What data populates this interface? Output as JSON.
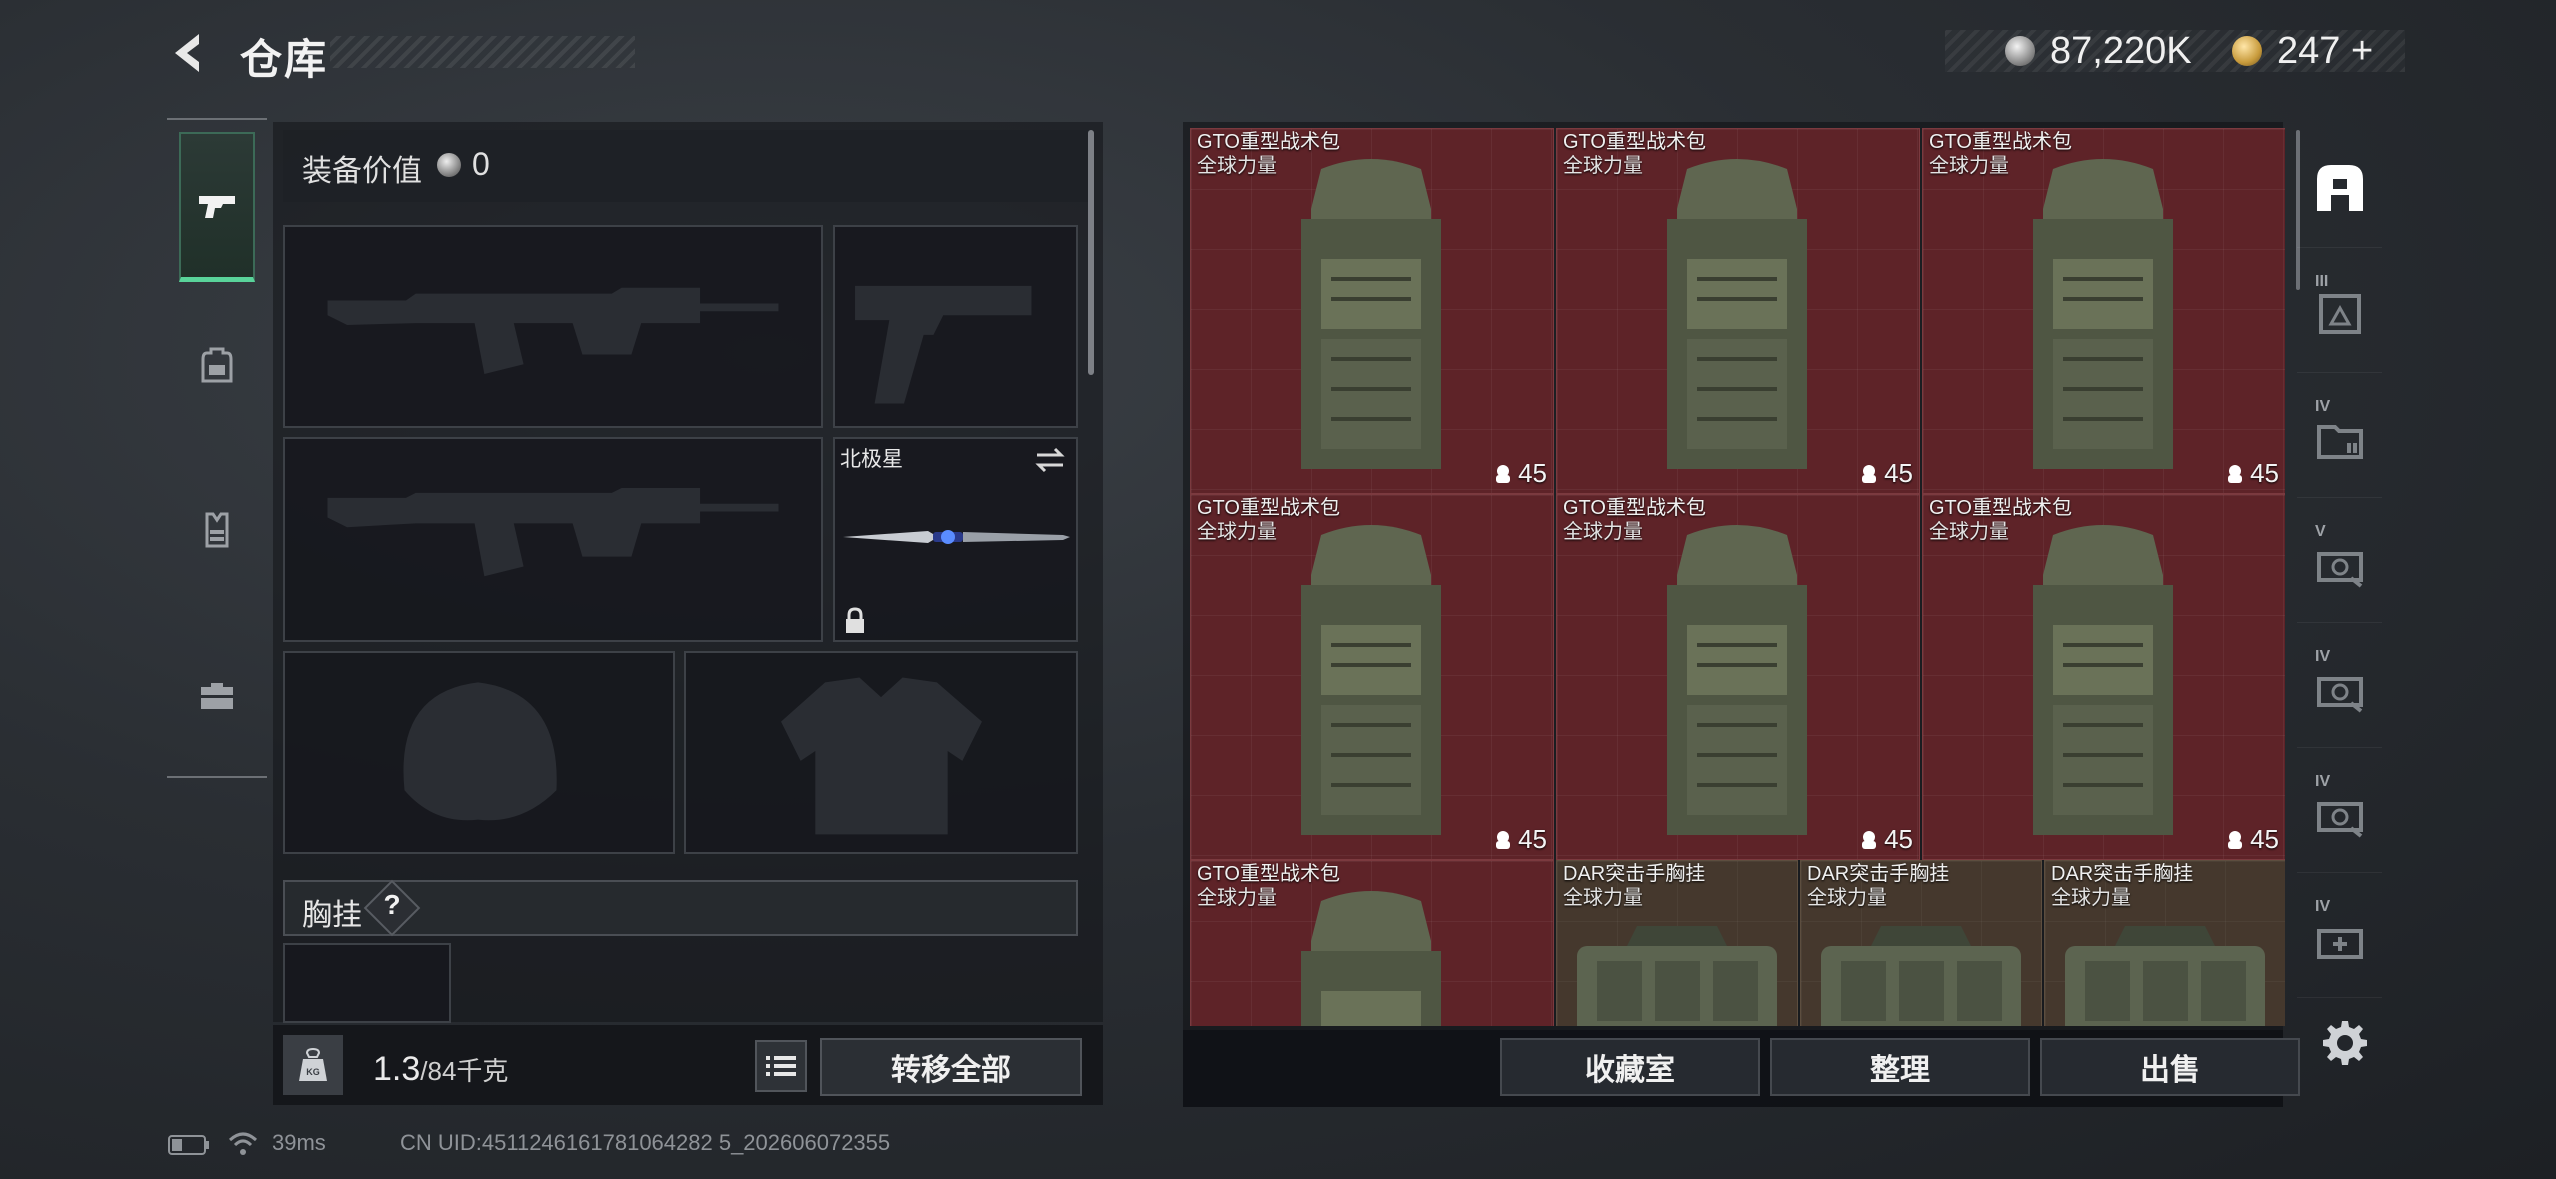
{
  "topbar": {
    "title": "仓库",
    "silver_amount": "87,220K",
    "gold_amount": "247",
    "gold_add": "+"
  },
  "rail": {
    "tabs": [
      {
        "icon": "pistol-icon",
        "active": true
      },
      {
        "icon": "backpack-icon",
        "active": false
      },
      {
        "icon": "chest-rig-icon",
        "active": false
      },
      {
        "icon": "toolbox-icon",
        "active": false
      }
    ]
  },
  "equipment": {
    "value_label": "装备价值",
    "value_amount": "0",
    "melee_name": "北极星",
    "chest_label": "胸挂",
    "chest_help": "?"
  },
  "weight": {
    "current": "1.3",
    "max": "/84千克",
    "unit_icon_text": "KG"
  },
  "actions": {
    "transfer_all": "转移全部",
    "collection": "收藏室",
    "sort": "整理",
    "sell": "出售"
  },
  "storage": {
    "items": [
      {
        "name": "GTO重型战术包",
        "tag": "全球力量",
        "count": "45",
        "kind": "bag"
      },
      {
        "name": "GTO重型战术包",
        "tag": "全球力量",
        "count": "45",
        "kind": "bag"
      },
      {
        "name": "GTO重型战术包",
        "tag": "全球力量",
        "count": "45",
        "kind": "bag"
      },
      {
        "name": "GTO重型战术包",
        "tag": "全球力量",
        "count": "45",
        "kind": "bag"
      },
      {
        "name": "GTO重型战术包",
        "tag": "全球力量",
        "count": "45",
        "kind": "bag"
      },
      {
        "name": "GTO重型战术包",
        "tag": "全球力量",
        "count": "45",
        "kind": "bag"
      },
      {
        "name": "GTO重型战术包",
        "tag": "全球力量",
        "count": "",
        "kind": "bag"
      },
      {
        "name": "DAR突击手胸挂",
        "tag": "全球力量",
        "count": "",
        "kind": "vest"
      },
      {
        "name": "DAR突击手胸挂",
        "tag": "全球力量",
        "count": "",
        "kind": "vest"
      },
      {
        "name": "DAR突击手胸挂",
        "tag": "全球力量",
        "count": "",
        "kind": "vest"
      }
    ]
  },
  "right_rail": {
    "tabs": [
      {
        "icon": "storage-home-icon",
        "level": ""
      },
      {
        "icon": "storage-box-icon",
        "level": "III"
      },
      {
        "icon": "folder-storage-icon",
        "level": "IV"
      },
      {
        "icon": "cash-register-icon",
        "level": "V"
      },
      {
        "icon": "cash-register-icon",
        "level": "IV"
      },
      {
        "icon": "cash-register-icon",
        "level": "IV"
      },
      {
        "icon": "medical-box-icon",
        "level": "IV"
      }
    ]
  },
  "status": {
    "ping": "39ms",
    "uid": "CN UID:4511246161781064282 5_202606072355"
  },
  "colors": {
    "accent_green": "#59d39a",
    "bag_bg": "#5e2328",
    "vest_bg": "#45382d"
  }
}
